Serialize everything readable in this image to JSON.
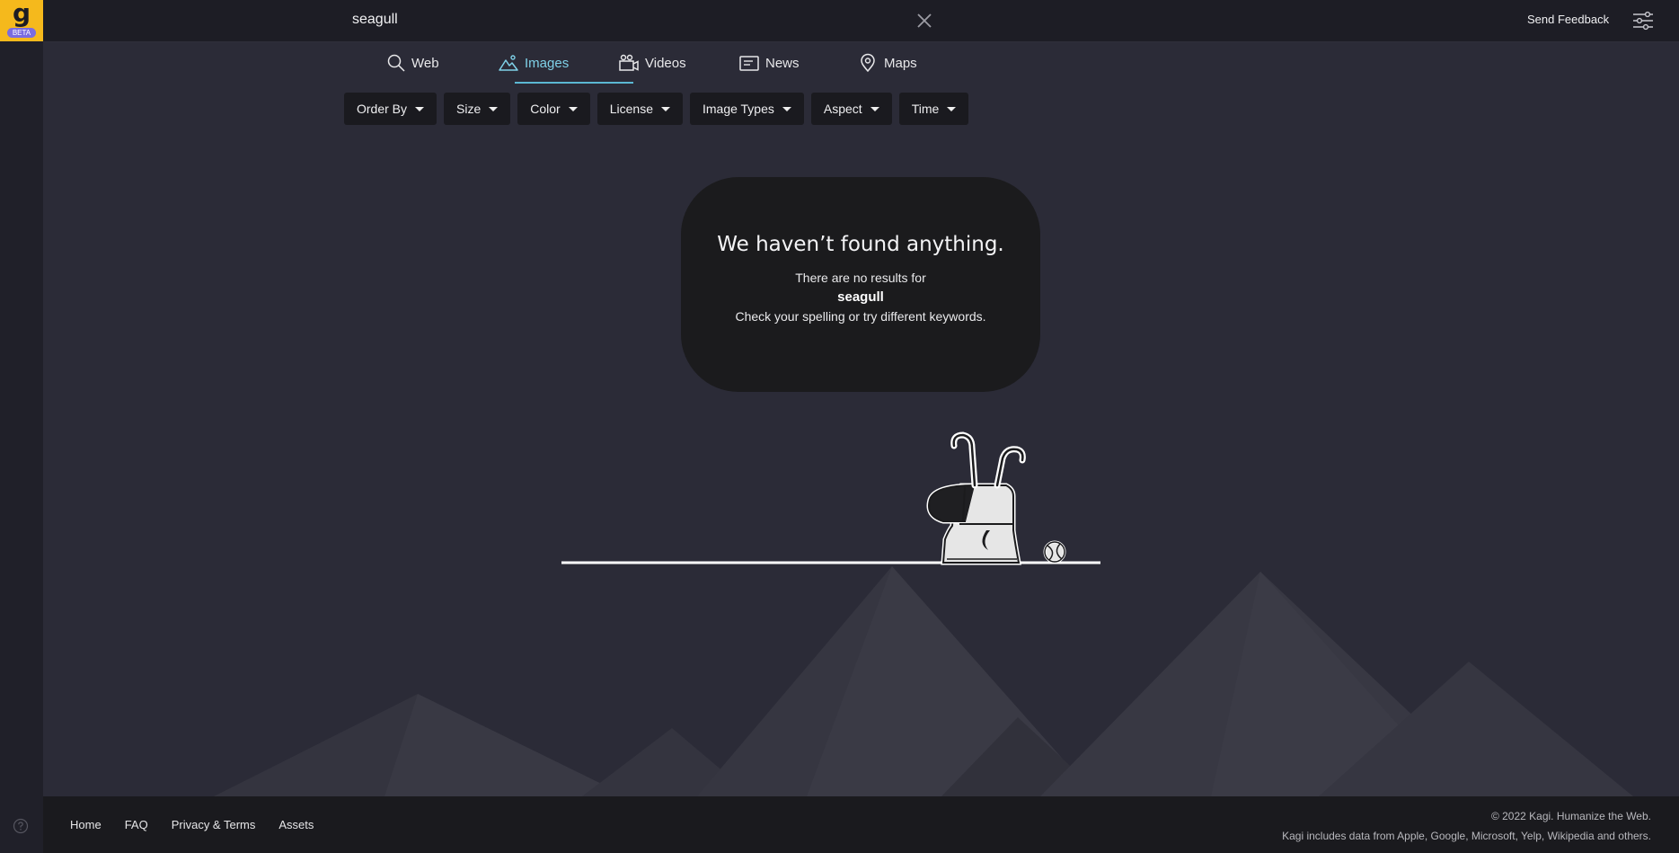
{
  "brand": {
    "logo_letter": "g",
    "badge": "BETA",
    "accent": "#f5b91c"
  },
  "search": {
    "query": "seagull"
  },
  "header": {
    "feedback_label": "Send Feedback"
  },
  "tabs": [
    {
      "label": "Web",
      "icon": "search-icon"
    },
    {
      "label": "Images",
      "icon": "mountain-image-icon",
      "active": true
    },
    {
      "label": "Videos",
      "icon": "video-camera-icon"
    },
    {
      "label": "News",
      "icon": "news-icon"
    },
    {
      "label": "Maps",
      "icon": "map-pin-icon"
    }
  ],
  "filters": [
    "Order By",
    "Size",
    "Color",
    "License",
    "Image Types",
    "Aspect",
    "Time"
  ],
  "empty_state": {
    "title": "We haven’t found anything.",
    "line1": "There are no results for",
    "query": "seagull",
    "hint": "Check your spelling or try different keywords."
  },
  "footer": {
    "links": [
      "Home",
      "FAQ",
      "Privacy & Terms",
      "Assets"
    ],
    "copyright": "© 2022 Kagi. Humanize the Web.",
    "credits": "Kagi includes data from Apple, Google, Microsoft, Yelp, Wikipedia and others."
  }
}
